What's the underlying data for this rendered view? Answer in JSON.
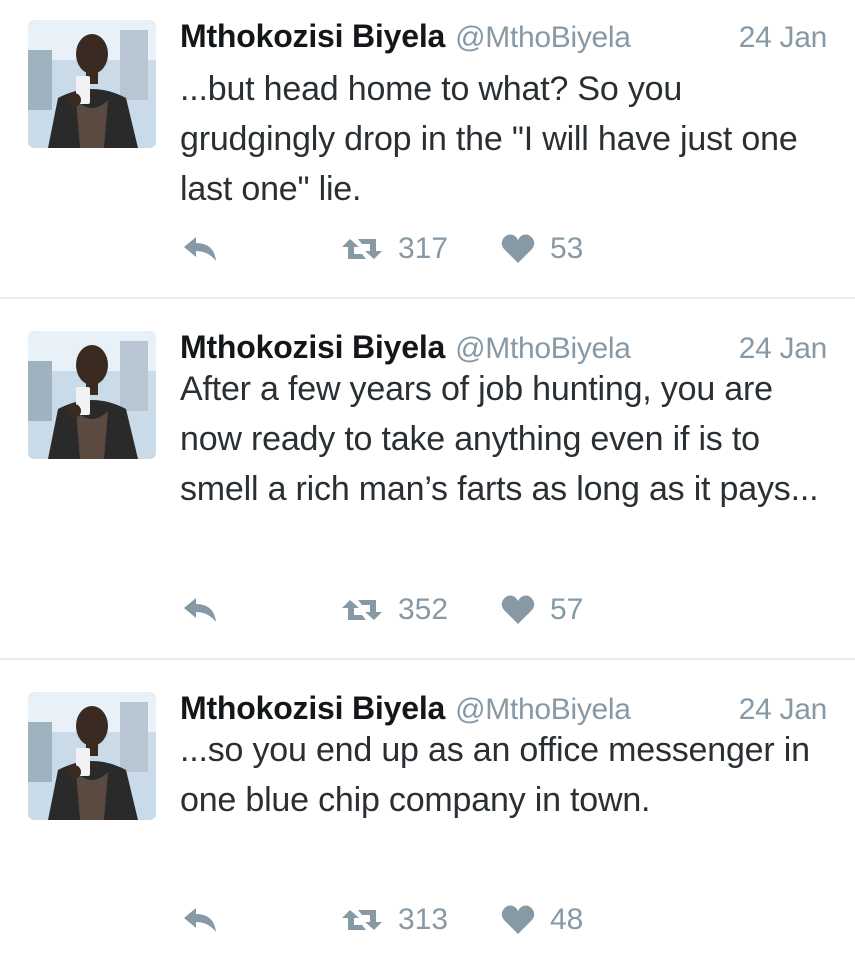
{
  "tweets": [
    {
      "name": "Mthokozisi Biyela",
      "handle": "@MthoBiyela",
      "date": "24 Jan",
      "text": "...but head home to what? So you grudgingly drop in the \"I will have just one last one\" lie.",
      "retweets": "317",
      "likes": "53"
    },
    {
      "name": "Mthokozisi Biyela",
      "handle": "@MthoBiyela",
      "date": "24 Jan",
      "text": "After a few years of job hunting, you are now ready to take anything even if is to smell a rich man’s farts as long as it pays...",
      "retweets": "352",
      "likes": "57"
    },
    {
      "name": "Mthokozisi Biyela",
      "handle": "@MthoBiyela",
      "date": "24 Jan",
      "text": "...so you end up as an office messenger in one blue chip company in town.",
      "retweets": "313",
      "likes": "48"
    }
  ],
  "icons": {
    "reply": "reply-icon",
    "retweet": "retweet-icon",
    "like": "heart-icon"
  },
  "colors": {
    "muted": "#8899a6",
    "text": "#292f33",
    "divider": "#e6ecf0"
  }
}
